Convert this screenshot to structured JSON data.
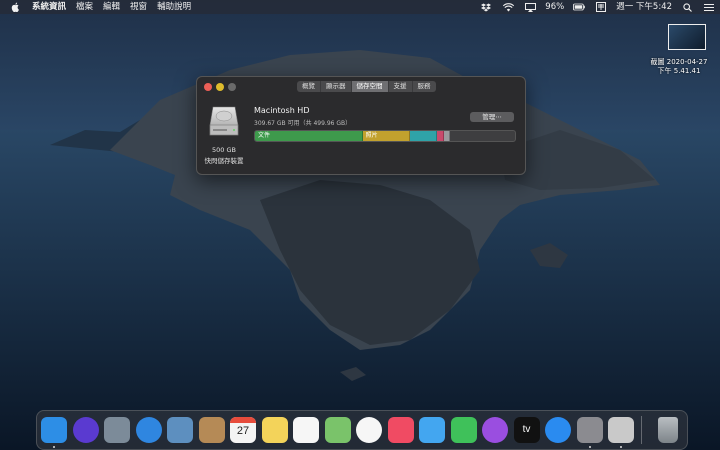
{
  "menubar": {
    "menus": [
      "系統資訊",
      "檔案",
      "編輯",
      "視窗",
      "輔助說明"
    ],
    "battery": "96%",
    "clock": "週一 下午5:42",
    "icons": [
      "apple-icon",
      "dropbox-icon",
      "wifi-icon",
      "airplay-icon",
      "battery-icon",
      "input-method-icon",
      "search-icon",
      "control-center-icon"
    ]
  },
  "desktop": {
    "screenshot_label_line1": "截圖 2020-04-27",
    "screenshot_label_line2": "下午 5.41.41"
  },
  "window": {
    "tabs": [
      {
        "label": "概覽",
        "active": false
      },
      {
        "label": "顯示器",
        "active": false
      },
      {
        "label": "儲存空間",
        "active": true
      },
      {
        "label": "支援",
        "active": false
      },
      {
        "label": "服務",
        "active": false
      }
    ],
    "disk": {
      "size": "500 GB",
      "kind": "快閃儲存裝置",
      "name": "Macintosh HD",
      "available": "309.67 GB 可用（共 499.96 GB）",
      "manage_label": "管理⋯"
    },
    "storage_bar": {
      "segments": [
        {
          "label": "文件",
          "fraction": 0.41,
          "color": "#3e9a4c"
        },
        {
          "label": "照片",
          "fraction": 0.18,
          "color": "#c2a12e"
        },
        {
          "label": "",
          "fraction": 0.1,
          "color": "#2fa3a8"
        },
        {
          "label": "",
          "fraction": 0.02,
          "color": "#c94a6c"
        },
        {
          "label": "",
          "fraction": 0.02,
          "color": "#9a9a9e"
        }
      ]
    }
  },
  "dock": {
    "items": [
      {
        "name": "finder",
        "color": "#2d8ee6",
        "running": true
      },
      {
        "name": "siri",
        "color": "#5a3ad0",
        "running": false
      },
      {
        "name": "launchpad",
        "color": "#7c8b99",
        "running": false
      },
      {
        "name": "safari",
        "color": "#2f86e0",
        "running": false
      },
      {
        "name": "preview",
        "color": "#5d8fbf",
        "running": false
      },
      {
        "name": "contacts",
        "color": "#b58a56",
        "running": false
      },
      {
        "name": "calendar",
        "color": "#f4f4f4",
        "running": false
      },
      {
        "name": "notes",
        "color": "#f3d35a",
        "running": false
      },
      {
        "name": "reminders",
        "color": "#f6f6f6",
        "running": false
      },
      {
        "name": "maps",
        "color": "#7ac36a",
        "running": false
      },
      {
        "name": "photos",
        "color": "#f6f6f6",
        "running": false
      },
      {
        "name": "music",
        "color": "#f04b63",
        "running": false
      },
      {
        "name": "messages",
        "color": "#43a6f0",
        "running": false
      },
      {
        "name": "facetime",
        "color": "#3fc15a",
        "running": false
      },
      {
        "name": "podcasts",
        "color": "#9a4ee0",
        "running": false
      },
      {
        "name": "apple-tv",
        "color": "#111111",
        "running": false
      },
      {
        "name": "app-store",
        "color": "#2a8bf0",
        "running": false
      },
      {
        "name": "system-preferences",
        "color": "#8b8b90",
        "running": true
      },
      {
        "name": "system-information",
        "color": "#c9c9c9",
        "running": true
      },
      {
        "name": "trash",
        "color": "#8e9499",
        "running": false
      }
    ],
    "calendar_day": "27",
    "appletv_label": "tv"
  }
}
